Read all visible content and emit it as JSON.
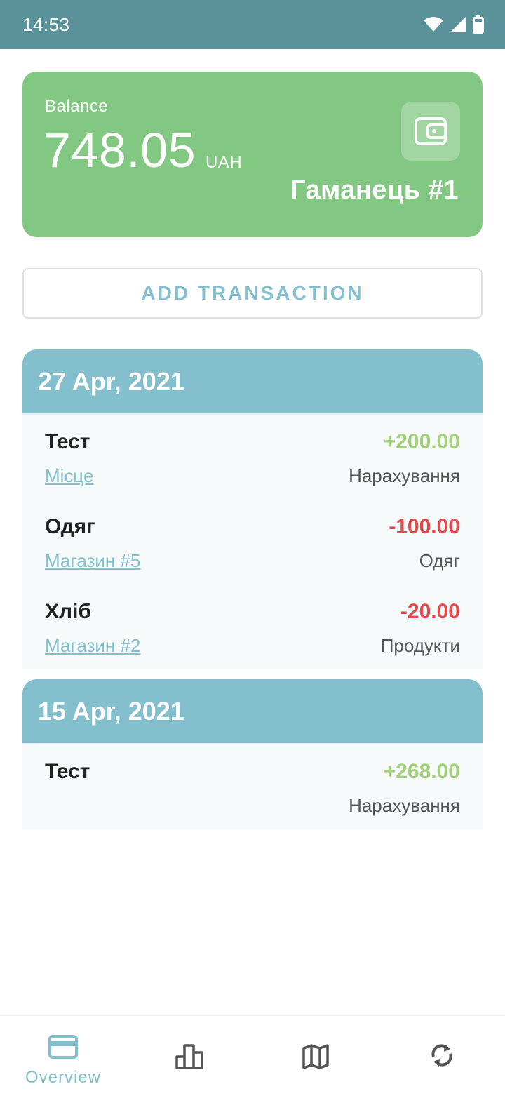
{
  "status_bar": {
    "time": "14:53"
  },
  "balance_card": {
    "label": "Balance",
    "amount": "748.05",
    "currency": "UAH",
    "wallet_name": "Гаманець #1",
    "color": "#82c782"
  },
  "add_transaction": {
    "label": "ADD TRANSACTION"
  },
  "days": [
    {
      "date": "27 Apr, 2021",
      "transactions": [
        {
          "name": "Тест",
          "amount": "+200.00",
          "place": "Місце",
          "category": "Нарахування"
        },
        {
          "name": "Одяг",
          "amount": "-100.00",
          "place": "Магазин #5",
          "category": "Одяг"
        },
        {
          "name": "Хліб",
          "amount": "-20.00",
          "place": "Магазин #2",
          "category": "Продукти"
        }
      ]
    },
    {
      "date": "15 Apr, 2021",
      "transactions": [
        {
          "name": "Тест",
          "amount": "+268.00",
          "place": "",
          "category": "Нарахування"
        }
      ]
    }
  ],
  "bottom_nav": {
    "items": [
      {
        "label": "Overview",
        "icon": "credit-card-icon",
        "active": true
      },
      {
        "label": "",
        "icon": "bar-chart-icon",
        "active": false
      },
      {
        "label": "",
        "icon": "map-icon",
        "active": false
      },
      {
        "label": "",
        "icon": "sync-icon",
        "active": false
      }
    ]
  },
  "colors": {
    "accent": "#84bfcd",
    "positive": "#a4cf7c",
    "negative": "#e4484a",
    "status_bar": "#5b9299"
  }
}
